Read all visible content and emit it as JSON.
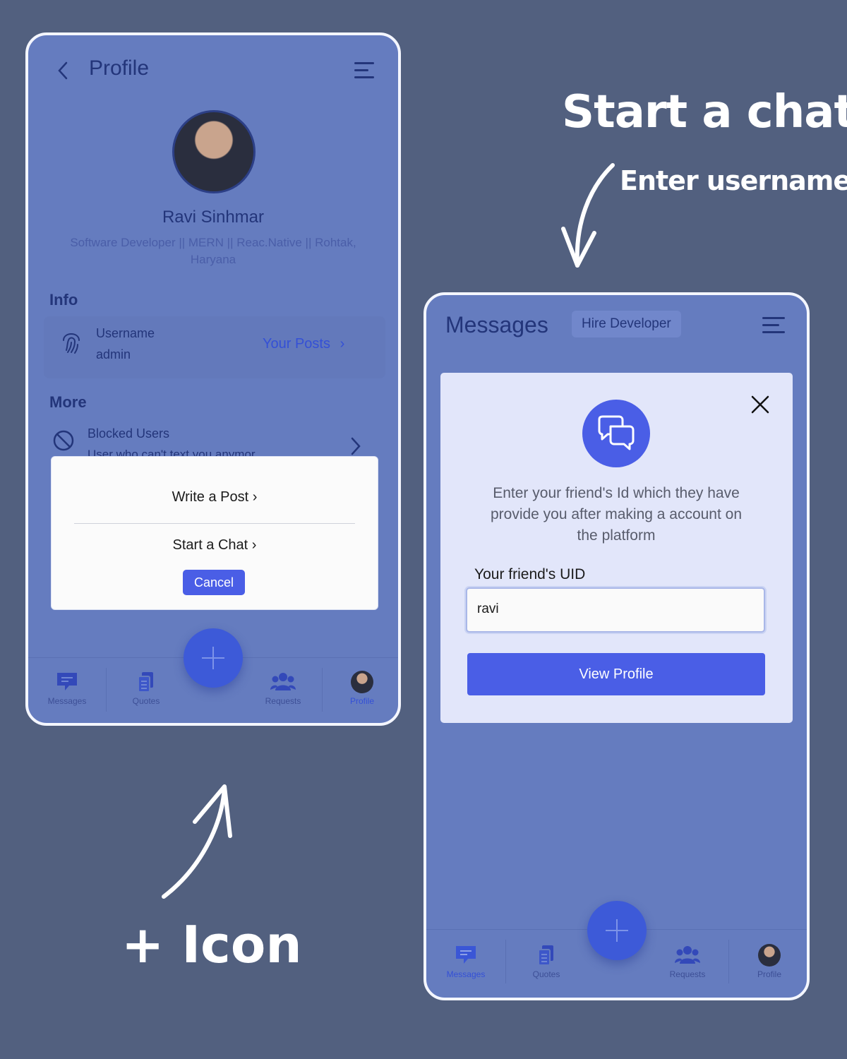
{
  "captions": {
    "start_chat": "Start a chat",
    "enter_username": "Enter username",
    "plus_icon": "+ Icon"
  },
  "profile_screen": {
    "title": "Profile",
    "user_name": "Ravi Sinhmar",
    "bio": "Software Developer || MERN || Reac.Native || Rohtak, Haryana",
    "info_heading": "Info",
    "username_label": "Username",
    "username_value": "admin",
    "your_posts_link": "Your Posts",
    "more_heading": "More",
    "blocked_users_title": "Blocked Users",
    "blocked_users_subtitle": "User who can't text you anymor",
    "action_sheet": {
      "write_post": "Write a Post",
      "start_chat": "Start a Chat",
      "cancel": "Cancel"
    },
    "nav": [
      "Messages",
      "Quotes",
      "Requests",
      "Profile"
    ]
  },
  "messages_screen": {
    "title": "Messages",
    "hire_button": "Hire Developer",
    "modal": {
      "description": "Enter your friend's Id which they have provide you after making a account on the platform",
      "uid_label": "Your friend's UID",
      "uid_value": "ravi",
      "view_profile_button": "View Profile"
    },
    "nav": [
      "Messages",
      "Quotes",
      "Requests",
      "Profile"
    ]
  },
  "colors": {
    "background": "#52607f",
    "screen_tint": "#657cbf",
    "primary": "#4a5ee6",
    "title_text": "#23357a"
  },
  "icons": [
    "back-chevron-icon",
    "menu-icon",
    "fingerprint-icon",
    "blocked-icon",
    "chat-bubbles-icon",
    "close-icon",
    "plus-icon",
    "messages-icon",
    "quotes-icon",
    "requests-icon"
  ]
}
